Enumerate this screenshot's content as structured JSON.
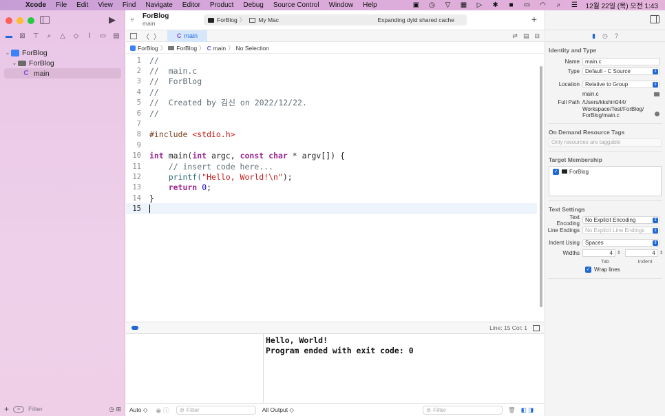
{
  "menubar": {
    "app_name": "Xcode",
    "items": [
      "File",
      "Edit",
      "View",
      "Find",
      "Navigate",
      "Editor",
      "Product",
      "Debug",
      "Source Control",
      "Window",
      "Help"
    ],
    "clock": "12월 22일 (목) 오전 1:43"
  },
  "toolbar": {
    "scheme_name": "ForBlog",
    "scheme_sub": "main",
    "run_destination_target": "ForBlog",
    "run_destination_device": "My Mac",
    "activity_status": "Expanding dyld shared cache"
  },
  "navigator": {
    "tree": [
      {
        "label": "ForBlog",
        "type": "project"
      },
      {
        "label": "ForBlog",
        "type": "folder"
      },
      {
        "label": "main",
        "type": "c-file"
      }
    ],
    "filter_placeholder": "Filter"
  },
  "editor": {
    "tab_label": "main",
    "breadcrumb": [
      "ForBlog",
      "ForBlog",
      "main",
      "No Selection"
    ],
    "line_numbers": [
      "1",
      "2",
      "3",
      "4",
      "5",
      "6",
      "7",
      "8",
      "9",
      "10",
      "11",
      "12",
      "13",
      "14",
      "15"
    ],
    "code": {
      "l1": "//",
      "l2": "//  main.c",
      "l3": "//  ForBlog",
      "l4": "//",
      "l5": "//  Created by 김신 on 2022/12/22.",
      "l6": "//",
      "l8_directive": "#include ",
      "l8_header": "<stdio.h>",
      "l10_kw1": "int",
      "l10_fn": " main(",
      "l10_kw2": "int",
      "l10_mid": " argc, ",
      "l10_kw3": "const",
      "l10_sp": " ",
      "l10_kw4": "char",
      "l10_end": " * argv[]) {",
      "l11": "    // insert code here...",
      "l12_fn": "    printf(",
      "l12_str": "\"Hello, World!\\n\"",
      "l12_end": ");",
      "l13_kw": "    return",
      "l13_sp": " ",
      "l13_num": "0",
      "l13_end": ";",
      "l14": "}"
    },
    "line_col": "Line: 15  Col: 1"
  },
  "debug": {
    "console_output": "Hello, World!\nProgram ended with exit code: 0",
    "vars_scope": "Auto ◇",
    "filter_placeholder": "Filter",
    "output_select": "All Output ◇"
  },
  "inspector": {
    "identity_title": "Identity and Type",
    "name_label": "Name",
    "name_value": "main.c",
    "type_label": "Type",
    "type_value": "Default - C Source",
    "location_label": "Location",
    "location_value": "Relative to Group",
    "location_file": "main.c",
    "fullpath_label": "Full Path",
    "fullpath_value": "/Users/kkshin044/\nWorkspace/Test/ForBlog/\nForBlog/main.c",
    "odrt_title": "On Demand Resource Tags",
    "odrt_placeholder": "Only resources are taggable",
    "membership_title": "Target Membership",
    "membership_target": "ForBlog",
    "text_settings_title": "Text Settings",
    "encoding_label": "Text Encoding",
    "encoding_value": "No Explicit Encoding",
    "line_endings_label": "Line Endings",
    "line_endings_value": "No Explicit Line Endings",
    "indent_using_label": "Indent Using",
    "indent_using_value": "Spaces",
    "widths_label": "Widths",
    "tab_width": "4",
    "indent_width": "4",
    "tab_sublabel": "Tab",
    "indent_sublabel": "Indent",
    "wrap_lines_label": "Wrap lines"
  }
}
